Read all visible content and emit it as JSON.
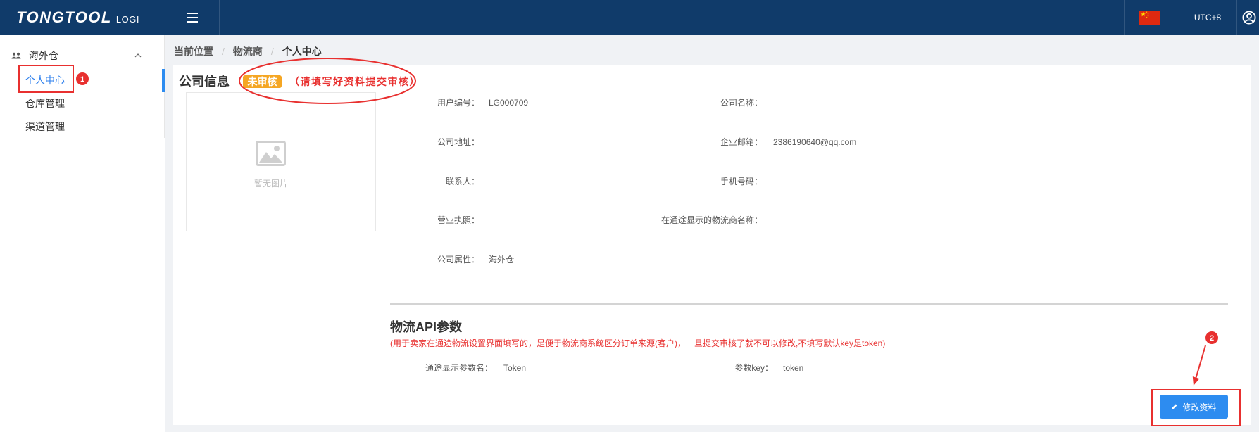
{
  "theme": {
    "header_bg": "#103b6a",
    "page_bg": "#f0f2f5",
    "accent": "#2d8cf0",
    "active_text": "#2f80ed",
    "badge_bg": "#f5a623",
    "alert_red": "#e8302f"
  },
  "icons": {
    "menu_toggle": "hamburger-icon",
    "language": "china-flag-icon",
    "account": "user-circle-icon",
    "group": "people-icon",
    "collapse": "chevron-up-icon",
    "placeholder_image": "image-placeholder-icon",
    "edit": "pencil-icon"
  },
  "header": {
    "logo_main": "TONGTOOL",
    "logo_sub": "LOGI",
    "timezone": "UTC+8"
  },
  "sidebar": {
    "group_label": "海外仓",
    "items": [
      {
        "label": "个人中心",
        "active": true
      },
      {
        "label": "仓库管理",
        "active": false
      },
      {
        "label": "渠道管理",
        "active": false
      }
    ]
  },
  "breadcrumb": {
    "separator": "/",
    "items": [
      "当前位置",
      "物流商",
      "个人中心"
    ]
  },
  "company": {
    "title": "公司信息",
    "status_badge": "未审核",
    "status_hint": "（请填写好资料提交审核）",
    "image_placeholder": "暂无图片",
    "fields_left": [
      {
        "label": "用户编号：",
        "value": "LG000709"
      },
      {
        "label": "公司地址：",
        "value": ""
      },
      {
        "label": "联系人：",
        "value": ""
      },
      {
        "label": "营业执照：",
        "value": ""
      },
      {
        "label": "公司属性：",
        "value": "海外仓"
      }
    ],
    "fields_right": [
      {
        "label": "公司名称：",
        "value": ""
      },
      {
        "label": "企业邮箱：",
        "value": "2386190640@qq.com"
      },
      {
        "label": "手机号码：",
        "value": ""
      },
      {
        "label": "在通途显示的物流商名称：",
        "value": ""
      }
    ]
  },
  "api": {
    "title": "物流API参数",
    "note": "(用于卖家在通途物流设置界面填写的，是便于物流商系统区分订单来源(客户)，一旦提交审核了就不可以修改,不填写默认key是token)",
    "params": [
      {
        "label": "通途显示参数名：",
        "value": "Token"
      },
      {
        "label": "参数key：",
        "value": "token"
      }
    ]
  },
  "actions": {
    "edit_button": "修改资料"
  },
  "annotations": {
    "step_1": "1",
    "step_2": "2"
  }
}
